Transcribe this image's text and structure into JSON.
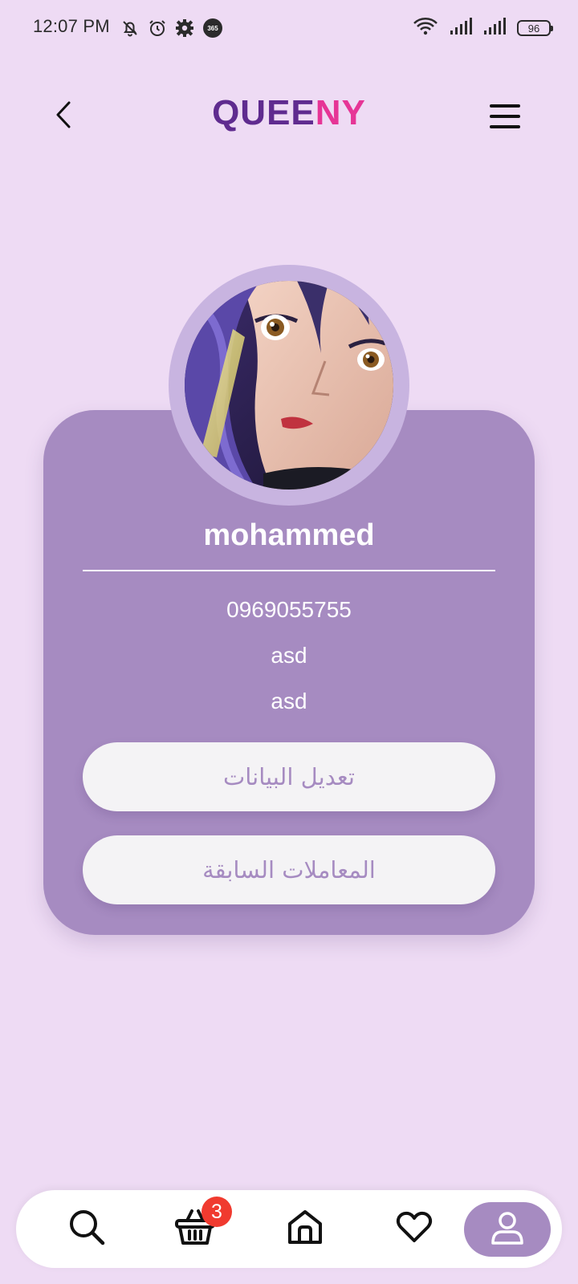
{
  "status_bar": {
    "time": "12:07 PM",
    "battery": "96",
    "icons": [
      "mute-bell-icon",
      "alarm-icon",
      "settings-gear-icon",
      "365-app-icon",
      "wifi-icon",
      "signal-icon",
      "signal-icon",
      "battery-icon"
    ]
  },
  "header": {
    "brand_part1": "QUEE",
    "brand_part2": "NY",
    "back_icon": "chevron-left-icon",
    "menu_icon": "hamburger-menu-icon"
  },
  "profile": {
    "name": "mohammed",
    "phone": "0969055755",
    "line1": "asd",
    "line2": "asd",
    "avatar": "anime-character-avatar"
  },
  "actions": {
    "edit_label": "تعديل البيانات",
    "history_label": "المعاملات السابقة"
  },
  "bottom_nav": {
    "items": [
      "search-icon",
      "basket-icon",
      "home-icon",
      "heart-icon",
      "user-icon"
    ],
    "active": "user-icon",
    "cart_badge": "3"
  },
  "colors": {
    "background": "#eedbf4",
    "card": "#a68bc1",
    "avatar_ring": "#c8b4e0",
    "brand_purple": "#5f2b8f",
    "brand_pink": "#e63596",
    "badge": "#f03a2f"
  }
}
